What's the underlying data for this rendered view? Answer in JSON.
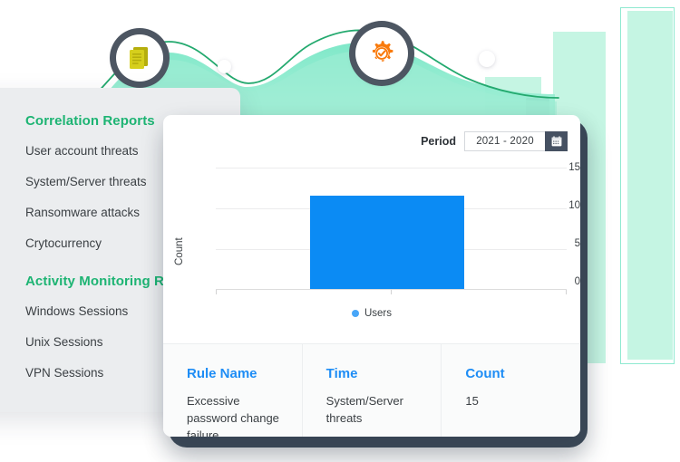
{
  "sidebar": {
    "sections": [
      {
        "heading": "Correlation Reports",
        "items": [
          "User account threats",
          "System/Server threats",
          "Ransomware attacks",
          "Crytocurrency"
        ]
      },
      {
        "heading": "Activity Monitoring Reports",
        "items": [
          "Windows Sessions",
          "Unix Sessions",
          "VPN Sessions"
        ]
      }
    ]
  },
  "card": {
    "period": {
      "label": "Period",
      "value": "2021 - 2020",
      "calendar_icon": "calendar-icon"
    }
  },
  "chart_data": {
    "type": "bar",
    "title": "",
    "xlabel": "",
    "ylabel": "Count",
    "categories": [
      "Users"
    ],
    "values": [
      11.5
    ],
    "series": [
      {
        "name": "Users",
        "values": [
          11.5
        ],
        "color": "#0b8bf4"
      }
    ],
    "yticks": [
      0,
      5,
      10,
      15
    ],
    "ylim": [
      0,
      15
    ],
    "grid": true,
    "legend": {
      "position": "bottom",
      "entries": [
        "Users"
      ]
    }
  },
  "table": {
    "columns": [
      "Rule Name",
      "Time",
      "Count"
    ],
    "rows": [
      [
        "Excessive password change failure",
        "System/Server threats",
        "15"
      ]
    ]
  },
  "decor": {
    "report_badge_icon": "document-report-icon",
    "settings_badge_icon": "gear-check-icon",
    "colors": {
      "mint": "#c5f5e3",
      "wave": "#7fe8c8",
      "wave_line": "#23a96e",
      "accent_green": "#1db473",
      "accent_blue": "#1e8df5",
      "bar_blue": "#0b8bf4",
      "frame_dark": "#3b4857",
      "sidebar_bg": "#ebedef",
      "orange": "#f97a0b",
      "olive": "#c9c312"
    }
  }
}
